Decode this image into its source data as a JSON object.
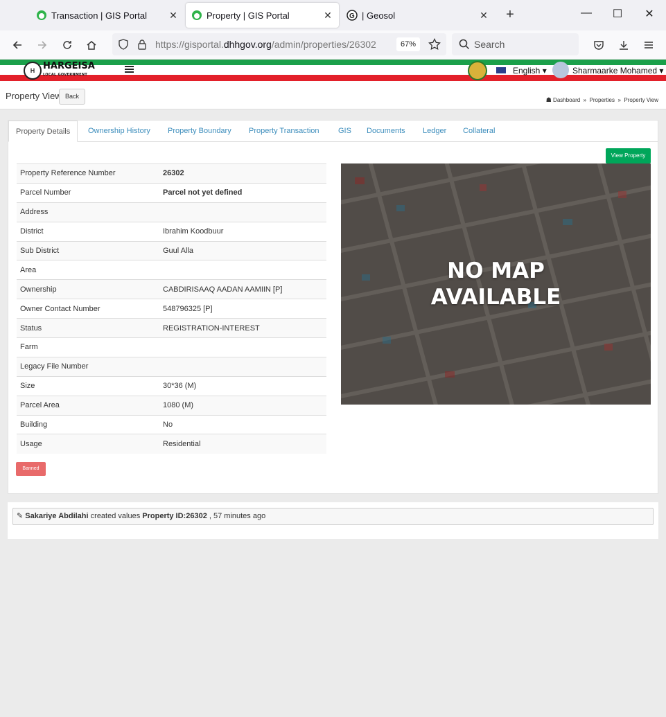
{
  "browser": {
    "tabs": [
      {
        "label": "Transaction | GIS Portal",
        "active": false
      },
      {
        "label": "Property | GIS Portal",
        "active": true
      },
      {
        "label": "| Geosol",
        "active": false
      }
    ],
    "url_prefix": "https://gisportal.",
    "url_domain": "dhhgov.org",
    "url_path": "/admin/properties/26302",
    "zoom": "67%",
    "search_placeholder": "Search"
  },
  "site": {
    "logo_text": "HARGEISA",
    "logo_sub": "LOCAL GOVERNMENT",
    "language": "English",
    "user": "Sharmaarke Mohamed"
  },
  "page": {
    "title": "Property View",
    "back": "Back",
    "breadcrumb": [
      "Dashboard",
      "Properties",
      "Property View"
    ]
  },
  "tabs": [
    "Property Details",
    "Ownership History",
    "Property Boundary",
    "Property Transaction",
    "GIS",
    "Documents",
    "Ledger",
    "Collateral"
  ],
  "view_property": "View Property",
  "details": [
    {
      "label": "Property Reference Number",
      "value": "26302",
      "bold": true
    },
    {
      "label": "Parcel Number",
      "value": "Parcel not yet defined",
      "bold": true
    },
    {
      "label": "Address",
      "value": ""
    },
    {
      "label": "District",
      "value": "Ibrahim Koodbuur"
    },
    {
      "label": "Sub District",
      "value": "Guul Alla"
    },
    {
      "label": "Area",
      "value": ""
    },
    {
      "label": "Ownership",
      "value": "CABDIRISAAQ AADAN AAMIIN [P]"
    },
    {
      "label": "Owner Contact Number",
      "value": "548796325 [P]"
    },
    {
      "label": "Status",
      "value": "REGISTRATION-INTEREST"
    },
    {
      "label": "Farm",
      "value": ""
    },
    {
      "label": "Legacy File Number",
      "value": ""
    },
    {
      "label": "Size",
      "value": "30*36 (M)"
    },
    {
      "label": "Parcel Area",
      "value": "1080 (M)"
    },
    {
      "label": "Building",
      "value": "No"
    },
    {
      "label": "Usage",
      "value": "Residential"
    }
  ],
  "map": {
    "line1": "NO MAP",
    "line2": "AVAILABLE"
  },
  "banned": "Banned",
  "activity": {
    "user": "Sakariye Abdilahi",
    "action": "created values",
    "subject": "Property ID:26302",
    "time": ", 57 minutes ago"
  }
}
